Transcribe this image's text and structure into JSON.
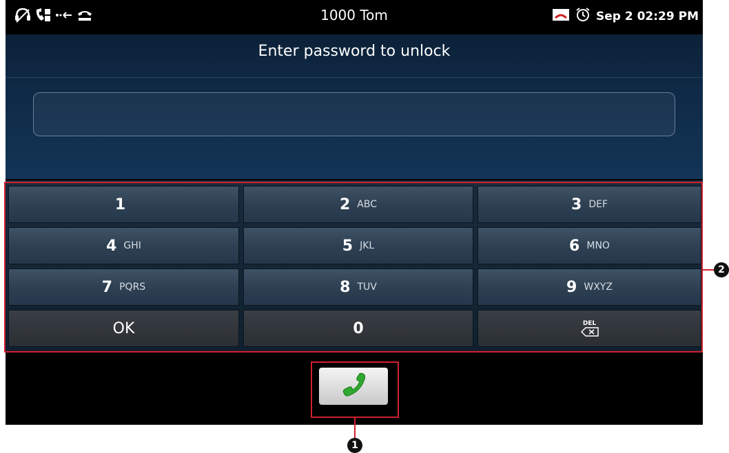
{
  "status_bar": {
    "center_text": "1000  Tom",
    "datetime": "Sep 2 02:29 PM",
    "left_icons": [
      "headset-icon",
      "handset-mute-icon",
      "call-forward-icon",
      "voicemail-icon"
    ],
    "right_icons": [
      "missed-call-icon",
      "alarm-icon"
    ]
  },
  "lock": {
    "title": "Enter password to unlock",
    "password_value": ""
  },
  "keypad": {
    "rows": [
      [
        {
          "num": "1",
          "letters": ""
        },
        {
          "num": "2",
          "letters": "ABC"
        },
        {
          "num": "3",
          "letters": "DEF"
        }
      ],
      [
        {
          "num": "4",
          "letters": "GHI"
        },
        {
          "num": "5",
          "letters": "JKL"
        },
        {
          "num": "6",
          "letters": "MNO"
        }
      ],
      [
        {
          "num": "7",
          "letters": "PQRS"
        },
        {
          "num": "8",
          "letters": "TUV"
        },
        {
          "num": "9",
          "letters": "WXYZ"
        }
      ]
    ],
    "ok_label": "OK",
    "zero_label": "0",
    "del_label": "DEL"
  },
  "call": {
    "icon": "phone-handset-icon"
  },
  "callouts": {
    "marker_1": "1",
    "marker_2": "2"
  },
  "colors": {
    "annotation": "#d2202f",
    "call_green": "#2fa82f"
  }
}
